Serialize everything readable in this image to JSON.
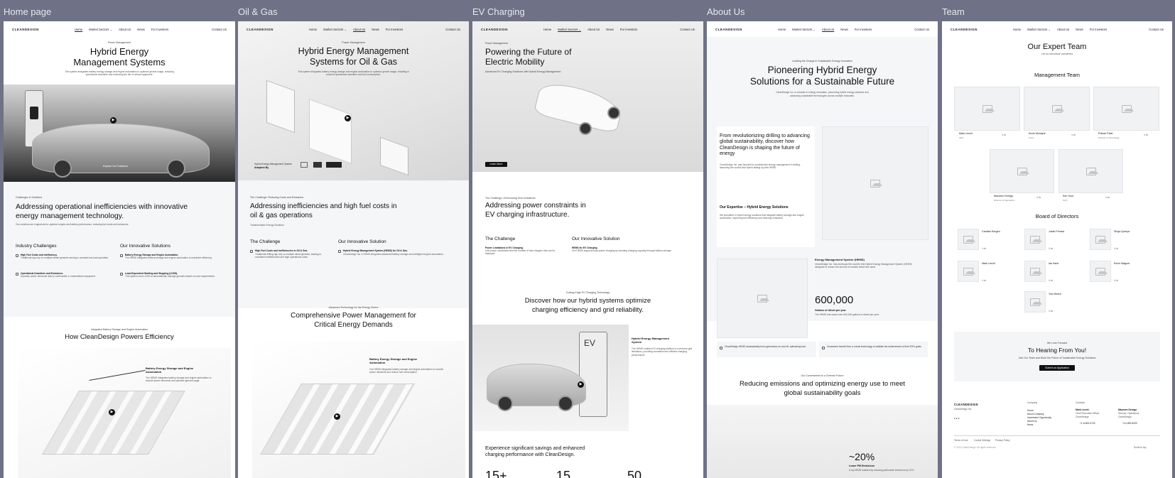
{
  "frames": [
    {
      "label": "Home page"
    },
    {
      "label": "Oil & Gas"
    },
    {
      "label": "EV Charging"
    },
    {
      "label": "About Us"
    },
    {
      "label": "Team"
    }
  ],
  "nav": {
    "logo": "CLEANDESIGN",
    "home": "Home",
    "markets": "Market Sectors ⌄",
    "about": "About Us",
    "news": "News",
    "investors": "For Investors",
    "contact": "Contact Us"
  },
  "home": {
    "eyebrow": "Power Management",
    "title_1": "Hybrid Energy",
    "title_2": "Management Systems",
    "desc_1": "This system integrates battery energy storage and engine automation to optimize genset usage, reducing",
    "desc_2": "operational downtime and extending the life of critical equipment.",
    "hero_btn": "Explore Our Solutions",
    "challenge_eyebrow": "Challenges & Solutions",
    "challenge_1": "Addressing operational inefficiencies with innovative",
    "challenge_2": "energy management technology.",
    "challenge_desc": "Our solutions are engineered to optimize engine and battery performance, reducing fuel costs and emissions.",
    "industry": "Industry Challenges",
    "innovative": "Our Innovative Solutions",
    "ic1_t": "High Fuel Costs and Inefficiency.",
    "ic1_d": "Traditional rigs rely on multiple diesel gensets running in constant low-load operation.",
    "ic2_t": "Operational Downtime and Emissions.",
    "ic2_d": "Dynamic power demands lead to overloaded or underutilized equipment.",
    "is1_t": "Battery Energy Storage and Engine Automation.",
    "is1_d": "The HEMS integrates battery storage and engine automation to maximize efficiency.",
    "is2_t": "Load-Dependent Starting and Stopping (LDSS).",
    "is2_d": "This system uses LDSS to automatically manage gensets based on load requirements.",
    "how_eyebrow": "Integrated Battery Storage and Engine Automation",
    "how_title": "How CleanDesign Powers Efficiency",
    "bess_1": "Battery Energy Storage and Engine",
    "bess_2": "Automation",
    "bess_d": "The HEMS integrates battery storage and engine automation to smooth power demands and optimize genset usage."
  },
  "oil": {
    "eyebrow": "Power Management",
    "title_1": "Hybrid Energy Management",
    "title_2": "Systems for Oil & Gas",
    "desc_1": "This system integrates battery energy storage and engine automation to optimize genset usage, resulting in",
    "desc_2": "reduced operational downtime and fuel consumption.",
    "adopted_1": "Hybrid Energy Management System",
    "adopted_2": "Adopted By",
    "challenge_eyebrow": "The Challenge: Reducing Costs and Emissions",
    "challenge_1": "Addressing inefficiencies and high fuel costs in",
    "challenge_2": "oil & gas operations",
    "challenge_sub": "Transformative Energy Solutions",
    "ch_t": "The Challenge",
    "sol_t": "Our Innovative Solution",
    "ch_b": "High Fuel Costs and Inefficiencies in Oil & Gas.",
    "sol_b": "Hybrid Energy Management System (HEMS) for Oil & Gas.",
    "ch_d": "Traditional drilling rigs rely on multiple diesel gensets, leading to consistent inefficiencies and high operational costs.",
    "sol_d": "CleanDesign Inc.'s HEMS integrates advanced battery storage and intelligent engine automation.",
    "adv_eyebrow": "Advanced Technology for the Energy Sector",
    "adv_1": "Comprehensive Power Management for",
    "adv_2": "Critical Energy Demands",
    "bess_1": "Battery Energy Storage and Engine",
    "bess_2": "Automation",
    "bess_d": "Our HEMS integrates battery storage and engine automation to smooth power demands and reduce fuel consumption."
  },
  "ev": {
    "eyebrow": "Power Management",
    "title_1": "Powering the Future of",
    "title_2": "Electric Mobility",
    "sub": "Advanced EV Charging Solutions with Hybrid Energy Management",
    "btn": "Learn More",
    "challenge_eyebrow": "The Challenge: Overcoming Grid Limitations",
    "challenge_1": "Addressing power constraints in",
    "challenge_2": "EV charging infrastructure.",
    "ch_t": "The Challenge",
    "sol_t": "Our Innovative Solution",
    "ch_b": "Power Limitations in EV Charging.",
    "sol_b": "HEMS for EV Charging.",
    "ch_d": "Grid power constraints limit the number of fast chargers that can be deployed.",
    "sol_d": "Our HEMS supports high-power charging by boosting charging capacity through battery storage.",
    "disc_eyebrow": "Cutting-Edge EV Charging Technology",
    "disc_1": "Discover how our hybrid systems optimize",
    "disc_2": "charging efficiency and grid reliability.",
    "hems_1": "Hybrid Energy Management",
    "hems_2": "System",
    "hems_d": "The HEMS enables EV charging stations to overcome grid limitations, providing consistent and efficient charging performance.",
    "exp_1": "Experience significant savings and enhanced",
    "exp_2": "charging performance with CleanDesign.",
    "s1": "15+",
    "s2": "15",
    "s3": "50"
  },
  "about": {
    "eyebrow": "Leading the Charge in Sustainable Energy Innovation",
    "title_1": "Pioneering Hybrid Energy",
    "title_2": "Solutions for a Sustainable Future",
    "desc_1": "CleanDesign Inc. is a leader in energy innovation, pioneering hybrid energy solutions and",
    "desc_2": "advancing sustainable technologies across multiple industries.",
    "rev_1": "From revolutionizing drilling to advancing",
    "rev_2": "global sustainability, discover how",
    "rev_3": "CleanDesign is shaping the future of",
    "rev_4": "energy",
    "rev_d": "CleanDesign Inc. was founded to revolutionize energy management in drilling, launching the world's first hybrid drilling rig with HEMS.",
    "exp_t": "Our Expertise – Hybrid Energy Solutions",
    "exp_d": "We specialize in hybrid energy solutions that integrate battery storage and engine automation, improving fuel efficiency and reducing emissions.",
    "hems_t": "Energy Management System (HEMS)",
    "hems_d": "CleanDesign Inc. has developed the world's first Hybrid Energy Management System (HEMS) designed to reduce the amount of harmful diesel fuel used.",
    "stat": "600,000",
    "stat_l": "Gallons of diesel per year",
    "stat_d": "The HEMS has saved over 600,000 gallons of diesel per year.",
    "q1": "CleanDesign HEMS automatically turns generators on and off, optimizing load.",
    "q2": "Customers benefit from a robust technology to validate the achievement of their ESG goals.",
    "commit_eyebrow": "Our Commitment to a Greener Future",
    "commit_1": "Reducing emissions and optimizing energy use to meet",
    "commit_2": "global sustainability goals",
    "pct": "~20%",
    "pct_l": "Lower PM Emissions",
    "pct_d": "A rig HEMS enabled by reducing particulate emissions by 12%."
  },
  "team": {
    "title": "Our Expert Team",
    "sub": "Let us introduce ourselves",
    "mgmt": "Management Team",
    "m1_n": "Mark Lerchl",
    "m1_r": "CEO",
    "m2_n": "Kevin McIntyre",
    "m2_r": "COO",
    "m3_n": "Pritesh Patel",
    "m3_r": "Director of Technology",
    "m4_n": "Maureen Derrigo",
    "m4_r": "Director of Operations",
    "m5_n": "Ken Yoon",
    "m5_r": "CFO",
    "board": "Board of Directors",
    "b1": "Candice Bergen",
    "b2": "Justin Ferrara",
    "b3": "Shuja Qureya",
    "b4": "Mark Lerchl",
    "b5": "Ian Kane",
    "b6": "Kevin Wagner",
    "b7": "Tom Welch",
    "cta_eyebrow": "We Look Forward",
    "cta_title": "To Hearing From You!",
    "cta_d": "Join Our Team and Build the Future of Sustainable Energy Solutions",
    "cta_btn": "Submit an Application",
    "f_logo": "CLEANDESIGN",
    "f_co": "CleanDesign Inc.",
    "f_company": "Company",
    "f_links": [
      "Home",
      "About Company",
      "Investment Opportunity",
      "About Us",
      "News"
    ],
    "f_contacts": "Contacts",
    "f_c1_n": "Mark Lerchl",
    "f_c1_r": "Chief Executive Officer",
    "f_c1_o": "CleanDesign",
    "f_c1_p": "+1-6-800-4732",
    "f_c2_n": "Maureen Derrigo",
    "f_c2_r": "Director, Operations",
    "f_c2_o": "CleanDesign",
    "f_c2_p": "+14-282-8429",
    "f_terms": "Terms of Use",
    "f_cookie": "Cookie Settings",
    "f_privacy": "Privacy Policy",
    "f_scroll": "Scroll to top",
    "f_copy": "© 2024 CleanDesign. All rights reserved."
  },
  "colors": {
    "canvas": "#6f7286",
    "accent": "#111111",
    "section": "#f5f6f8"
  }
}
